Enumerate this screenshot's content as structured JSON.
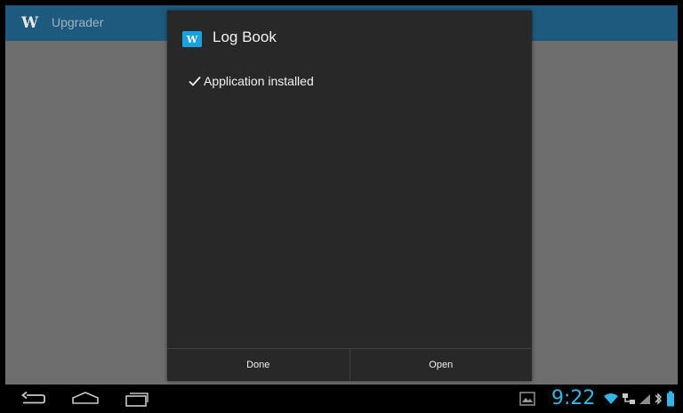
{
  "app": {
    "title": "Upgrader",
    "logo": "W"
  },
  "dialog": {
    "icon_letter": "W",
    "title": "Log Book",
    "status_icon": "check-icon",
    "status_text": "Application installed",
    "buttons": {
      "done": "Done",
      "open": "Open"
    }
  },
  "system_bar": {
    "nav_icons": [
      "back-icon",
      "home-icon",
      "recent-apps-icon"
    ],
    "notification_icon": "gallery-notification-icon",
    "clock": "9:22",
    "status_icons": [
      "wifi-icon",
      "network-icon",
      "signal-icon",
      "bluetooth-icon",
      "battery-icon"
    ]
  },
  "colors": {
    "app_bar": "#1d5a7e",
    "content_bg": "#6e6e6e",
    "dialog_bg": "#282828",
    "accent": "#33b5e5"
  }
}
